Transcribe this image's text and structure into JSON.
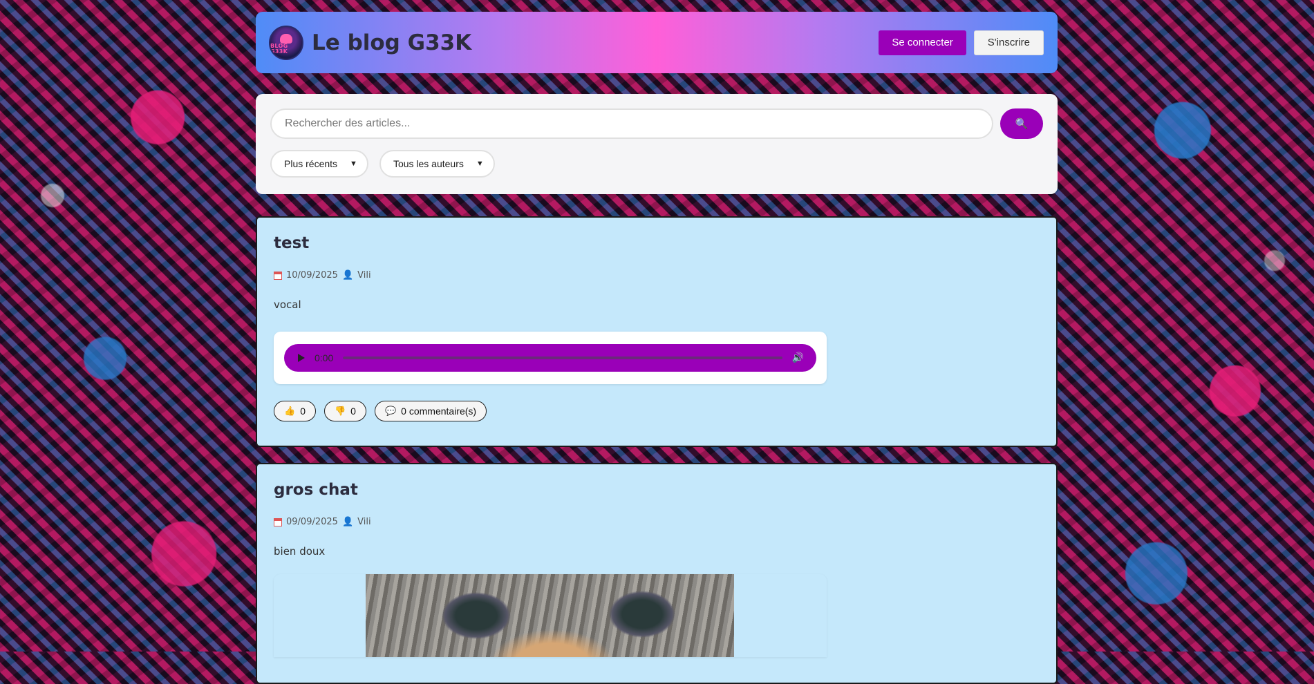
{
  "header": {
    "logo_text": "BLOG G33K",
    "title": "Le blog G33K",
    "login_label": "Se connecter",
    "signup_label": "S'inscrire",
    "colors": {
      "gradient_start": "#4f8cf7",
      "gradient_mid": "#ff5fd8",
      "button_purple": "#9a00b8"
    }
  },
  "search": {
    "placeholder": "Rechercher des articles...",
    "button_icon": "search-icon",
    "sort_selected": "Plus récents",
    "author_selected": "Tous les auteurs"
  },
  "posts": [
    {
      "title": "test",
      "date": "10/09/2025",
      "author": "Vili",
      "body": "vocal",
      "media": "audio",
      "audio_time": "0:00",
      "likes": "0",
      "dislikes": "0",
      "comments": "0 commentaire(s)"
    },
    {
      "title": "gros chat",
      "date": "09/09/2025",
      "author": "Vili",
      "body": "bien doux",
      "media": "image"
    }
  ]
}
